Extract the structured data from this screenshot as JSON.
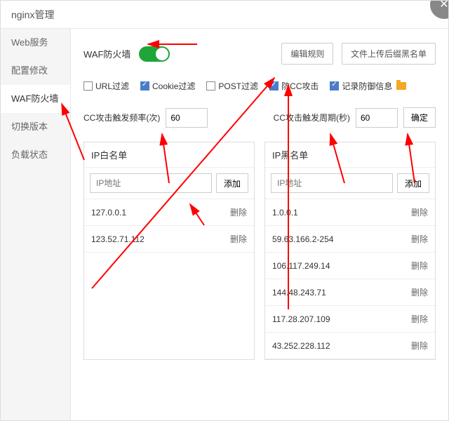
{
  "header": {
    "title": "nginx管理"
  },
  "sidebar": {
    "items": [
      {
        "label": "Web服务"
      },
      {
        "label": "配置修改"
      },
      {
        "label": "WAF防火墙"
      },
      {
        "label": "切换版本"
      },
      {
        "label": "负载状态"
      }
    ],
    "active_index": 2
  },
  "waf": {
    "label": "WAF防火墙",
    "enabled": true,
    "edit_rules_label": "编辑规则",
    "upload_blacklist_label": "文件上传后缀黑名单"
  },
  "filters": [
    {
      "label": "URL过滤",
      "checked": false
    },
    {
      "label": "Cookie过滤",
      "checked": true
    },
    {
      "label": "POST过滤",
      "checked": false
    },
    {
      "label": "防CC攻击",
      "checked": true
    },
    {
      "label": "记录防御信息",
      "checked": true,
      "has_folder": true
    }
  ],
  "cc": {
    "freq_label": "CC攻击触发频率(次)",
    "freq_value": "60",
    "period_label": "CC攻击触发周期(秒)",
    "period_value": "60",
    "confirm_label": "确定"
  },
  "lists": {
    "whitelist": {
      "title": "IP白名单",
      "placeholder": "IP地址",
      "add_label": "添加",
      "del_label": "删除",
      "items": [
        "127.0.0.1",
        "123.52.71.112"
      ]
    },
    "blacklist": {
      "title": "IP黑名单",
      "placeholder": "IP地址",
      "add_label": "添加",
      "del_label": "删除",
      "items": [
        "1.0.0.1",
        "59.63.166.2-254",
        "106.117.249.14",
        "144.48.243.71",
        "117.28.207.109",
        "43.252.228.112"
      ]
    }
  }
}
